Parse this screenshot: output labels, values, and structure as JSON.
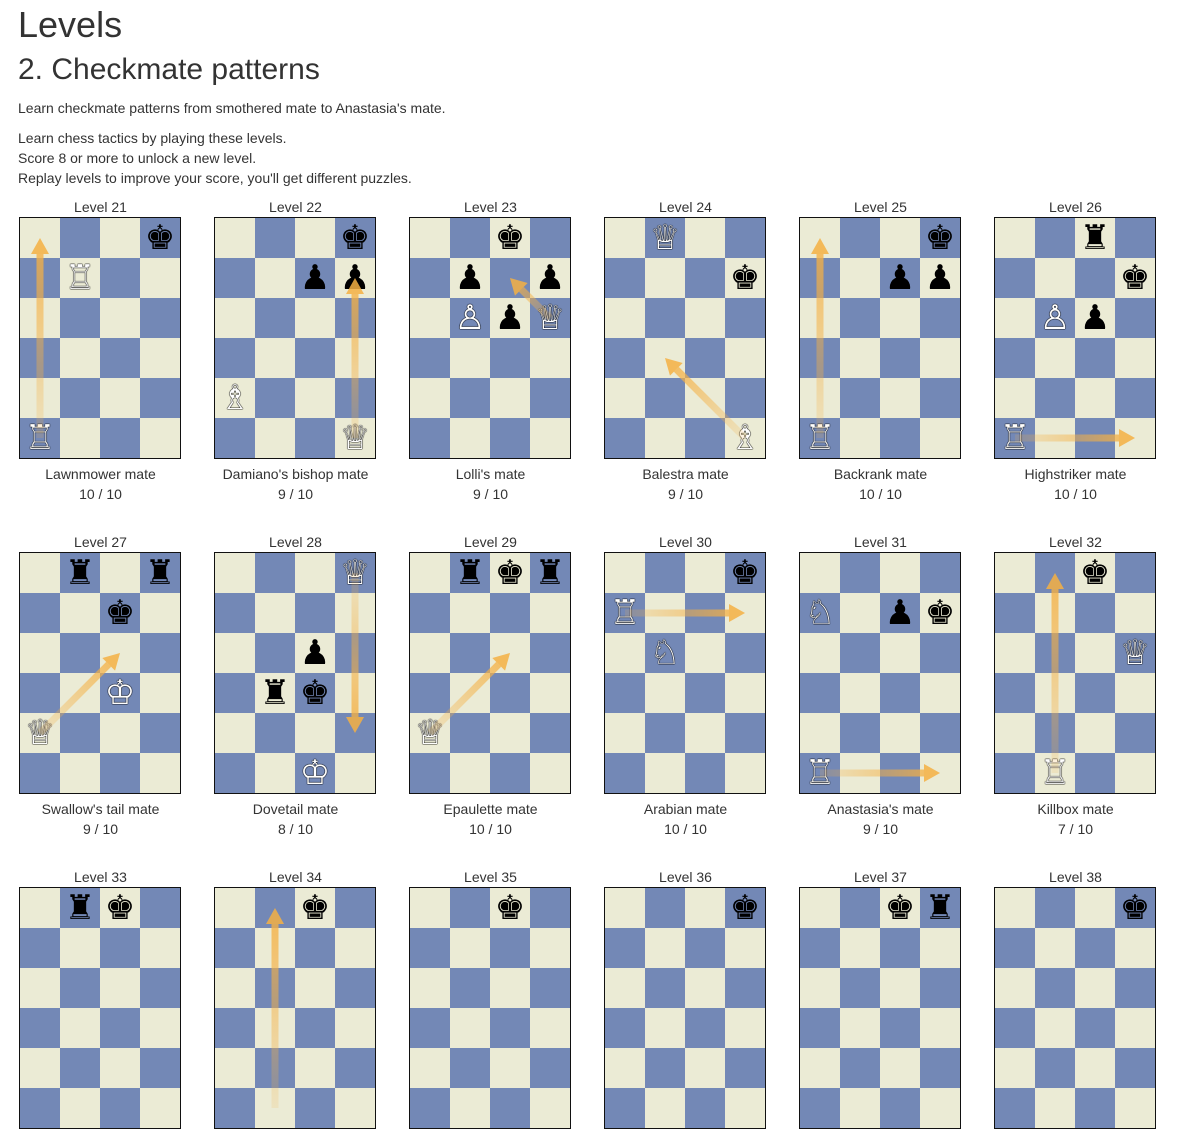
{
  "page": {
    "title": "Levels",
    "section_title": "2. Checkmate patterns",
    "description": "Learn checkmate patterns from smothered mate to Anastasia's mate.",
    "intro_lines": [
      "Learn chess tactics by playing these levels.",
      "Score 8 or more to unlock a new level.",
      "Replay levels to improve your score, you'll get different puzzles."
    ]
  },
  "colors": {
    "light_square": "#ebebd5",
    "dark_square": "#7388b6",
    "arrow": "#f5b043"
  },
  "levels": [
    {
      "title": "Level 21",
      "name": "Lawnmower mate",
      "score": "10 / 10",
      "pieces": [
        {
          "p": "k",
          "c": "b",
          "col": 3,
          "row": 0
        },
        {
          "p": "r",
          "c": "w",
          "col": 1,
          "row": 1
        },
        {
          "p": "r",
          "c": "w",
          "col": 0,
          "row": 5
        }
      ],
      "arrow": {
        "from": [
          0,
          5
        ],
        "to": [
          0,
          0
        ]
      }
    },
    {
      "title": "Level 22",
      "name": "Damiano's bishop mate",
      "score": "9 / 10",
      "pieces": [
        {
          "p": "k",
          "c": "b",
          "col": 3,
          "row": 0
        },
        {
          "p": "p",
          "c": "b",
          "col": 2,
          "row": 1
        },
        {
          "p": "p",
          "c": "b",
          "col": 3,
          "row": 1
        },
        {
          "p": "b",
          "c": "w",
          "col": 0,
          "row": 4
        },
        {
          "p": "q",
          "c": "w",
          "col": 3,
          "row": 5
        }
      ],
      "arrow": {
        "from": [
          3,
          5
        ],
        "to": [
          3,
          1
        ]
      }
    },
    {
      "title": "Level 23",
      "name": "Lolli's mate",
      "score": "9 / 10",
      "pieces": [
        {
          "p": "k",
          "c": "b",
          "col": 2,
          "row": 0
        },
        {
          "p": "p",
          "c": "b",
          "col": 1,
          "row": 1
        },
        {
          "p": "p",
          "c": "b",
          "col": 3,
          "row": 1
        },
        {
          "p": "p",
          "c": "w",
          "col": 1,
          "row": 2
        },
        {
          "p": "p",
          "c": "b",
          "col": 2,
          "row": 2
        },
        {
          "p": "q",
          "c": "w",
          "col": 3,
          "row": 2
        }
      ],
      "arrow": {
        "from": [
          3,
          2
        ],
        "to": [
          2,
          1
        ]
      }
    },
    {
      "title": "Level 24",
      "name": "Balestra mate",
      "score": "9 / 10",
      "pieces": [
        {
          "p": "q",
          "c": "w",
          "col": 1,
          "row": 0
        },
        {
          "p": "k",
          "c": "b",
          "col": 3,
          "row": 1
        },
        {
          "p": "b",
          "c": "w",
          "col": 3,
          "row": 5
        }
      ],
      "arrow": {
        "from": [
          3,
          5
        ],
        "to": [
          1,
          3
        ]
      }
    },
    {
      "title": "Level 25",
      "name": "Backrank mate",
      "score": "10 / 10",
      "pieces": [
        {
          "p": "k",
          "c": "b",
          "col": 3,
          "row": 0
        },
        {
          "p": "p",
          "c": "b",
          "col": 2,
          "row": 1
        },
        {
          "p": "p",
          "c": "b",
          "col": 3,
          "row": 1
        },
        {
          "p": "r",
          "c": "w",
          "col": 0,
          "row": 5
        }
      ],
      "arrow": {
        "from": [
          0,
          5
        ],
        "to": [
          0,
          0
        ]
      }
    },
    {
      "title": "Level 26",
      "name": "Highstriker mate",
      "score": "10 / 10",
      "pieces": [
        {
          "p": "r",
          "c": "b",
          "col": 2,
          "row": 0
        },
        {
          "p": "k",
          "c": "b",
          "col": 3,
          "row": 1
        },
        {
          "p": "p",
          "c": "w",
          "col": 1,
          "row": 2
        },
        {
          "p": "p",
          "c": "b",
          "col": 2,
          "row": 2
        },
        {
          "p": "r",
          "c": "w",
          "col": 0,
          "row": 5
        }
      ],
      "arrow": {
        "from": [
          0,
          5
        ],
        "to": [
          3,
          5
        ]
      }
    },
    {
      "title": "Level 27",
      "name": "Swallow's tail mate",
      "score": "9 / 10",
      "pieces": [
        {
          "p": "r",
          "c": "b",
          "col": 1,
          "row": 0
        },
        {
          "p": "r",
          "c": "b",
          "col": 3,
          "row": 0
        },
        {
          "p": "k",
          "c": "b",
          "col": 2,
          "row": 1
        },
        {
          "p": "k",
          "c": "w",
          "col": 2,
          "row": 3
        },
        {
          "p": "q",
          "c": "w",
          "col": 0,
          "row": 4
        }
      ],
      "arrow": {
        "from": [
          0,
          4
        ],
        "to": [
          2,
          2
        ]
      }
    },
    {
      "title": "Level 28",
      "name": "Dovetail mate",
      "score": "8 / 10",
      "pieces": [
        {
          "p": "q",
          "c": "w",
          "col": 3,
          "row": 0
        },
        {
          "p": "p",
          "c": "b",
          "col": 2,
          "row": 2
        },
        {
          "p": "r",
          "c": "b",
          "col": 1,
          "row": 3
        },
        {
          "p": "k",
          "c": "b",
          "col": 2,
          "row": 3
        },
        {
          "p": "k",
          "c": "w",
          "col": 2,
          "row": 5
        }
      ],
      "arrow": {
        "from": [
          3,
          0
        ],
        "to": [
          3,
          4
        ]
      }
    },
    {
      "title": "Level 29",
      "name": "Epaulette mate",
      "score": "10 / 10",
      "pieces": [
        {
          "p": "r",
          "c": "b",
          "col": 1,
          "row": 0
        },
        {
          "p": "k",
          "c": "b",
          "col": 2,
          "row": 0
        },
        {
          "p": "r",
          "c": "b",
          "col": 3,
          "row": 0
        },
        {
          "p": "q",
          "c": "w",
          "col": 0,
          "row": 4
        }
      ],
      "arrow": {
        "from": [
          0,
          4
        ],
        "to": [
          2,
          2
        ]
      }
    },
    {
      "title": "Level 30",
      "name": "Arabian mate",
      "score": "10 / 10",
      "pieces": [
        {
          "p": "k",
          "c": "b",
          "col": 3,
          "row": 0
        },
        {
          "p": "r",
          "c": "w",
          "col": 0,
          "row": 1
        },
        {
          "p": "n",
          "c": "w",
          "col": 1,
          "row": 2
        }
      ],
      "arrow": {
        "from": [
          0,
          1
        ],
        "to": [
          3,
          1
        ]
      }
    },
    {
      "title": "Level 31",
      "name": "Anastasia's mate",
      "score": "9 / 10",
      "pieces": [
        {
          "p": "n",
          "c": "w",
          "col": 0,
          "row": 1
        },
        {
          "p": "p",
          "c": "b",
          "col": 2,
          "row": 1
        },
        {
          "p": "k",
          "c": "b",
          "col": 3,
          "row": 1
        },
        {
          "p": "r",
          "c": "w",
          "col": 0,
          "row": 5
        }
      ],
      "arrow": {
        "from": [
          0,
          5
        ],
        "to": [
          3,
          5
        ]
      }
    },
    {
      "title": "Level 32",
      "name": "Killbox mate",
      "score": "7 / 10",
      "pieces": [
        {
          "p": "k",
          "c": "b",
          "col": 2,
          "row": 0
        },
        {
          "p": "q",
          "c": "w",
          "col": 3,
          "row": 2
        },
        {
          "p": "r",
          "c": "w",
          "col": 1,
          "row": 5
        }
      ],
      "arrow": {
        "from": [
          1,
          5
        ],
        "to": [
          1,
          0
        ]
      }
    },
    {
      "title": "Level 33",
      "name": "",
      "score": "",
      "pieces": [
        {
          "p": "r",
          "c": "b",
          "col": 1,
          "row": 0
        },
        {
          "p": "k",
          "c": "b",
          "col": 2,
          "row": 0
        }
      ],
      "arrow": null
    },
    {
      "title": "Level 34",
      "name": "",
      "score": "",
      "pieces": [
        {
          "p": "k",
          "c": "b",
          "col": 2,
          "row": 0
        }
      ],
      "arrow": {
        "from": [
          1,
          5
        ],
        "to": [
          1,
          0
        ]
      }
    },
    {
      "title": "Level 35",
      "name": "",
      "score": "",
      "pieces": [
        {
          "p": "k",
          "c": "b",
          "col": 2,
          "row": 0
        }
      ],
      "arrow": null
    },
    {
      "title": "Level 36",
      "name": "",
      "score": "",
      "pieces": [
        {
          "p": "k",
          "c": "b",
          "col": 3,
          "row": 0
        }
      ],
      "arrow": null
    },
    {
      "title": "Level 37",
      "name": "",
      "score": "",
      "pieces": [
        {
          "p": "k",
          "c": "b",
          "col": 2,
          "row": 0
        },
        {
          "p": "r",
          "c": "b",
          "col": 3,
          "row": 0
        }
      ],
      "arrow": null
    },
    {
      "title": "Level 38",
      "name": "",
      "score": "",
      "pieces": [
        {
          "p": "k",
          "c": "b",
          "col": 3,
          "row": 0
        }
      ],
      "arrow": null
    }
  ]
}
